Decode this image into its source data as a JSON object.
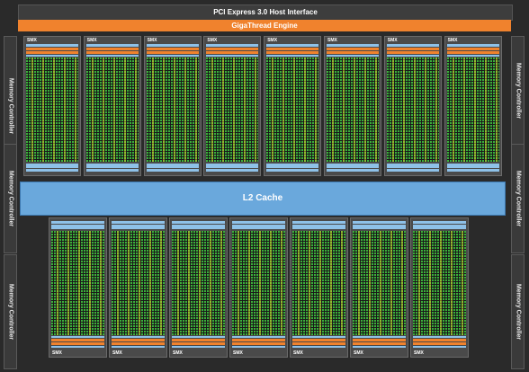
{
  "host_interface": "PCI Express 3.0 Host Interface",
  "gigathread": "GigaThread Engine",
  "l2_cache": "L2 Cache",
  "memory_controller_label": "Memory Controller",
  "smx_label": "SMX",
  "top_smx_count": 8,
  "bottom_smx_count": 7,
  "colors": {
    "gigathread": "#f0822d",
    "l2": "#6aa8dc",
    "core_green": "#3bb03b",
    "core_yellow": "#e6d228",
    "smx_blue": "#8ec1e8"
  }
}
